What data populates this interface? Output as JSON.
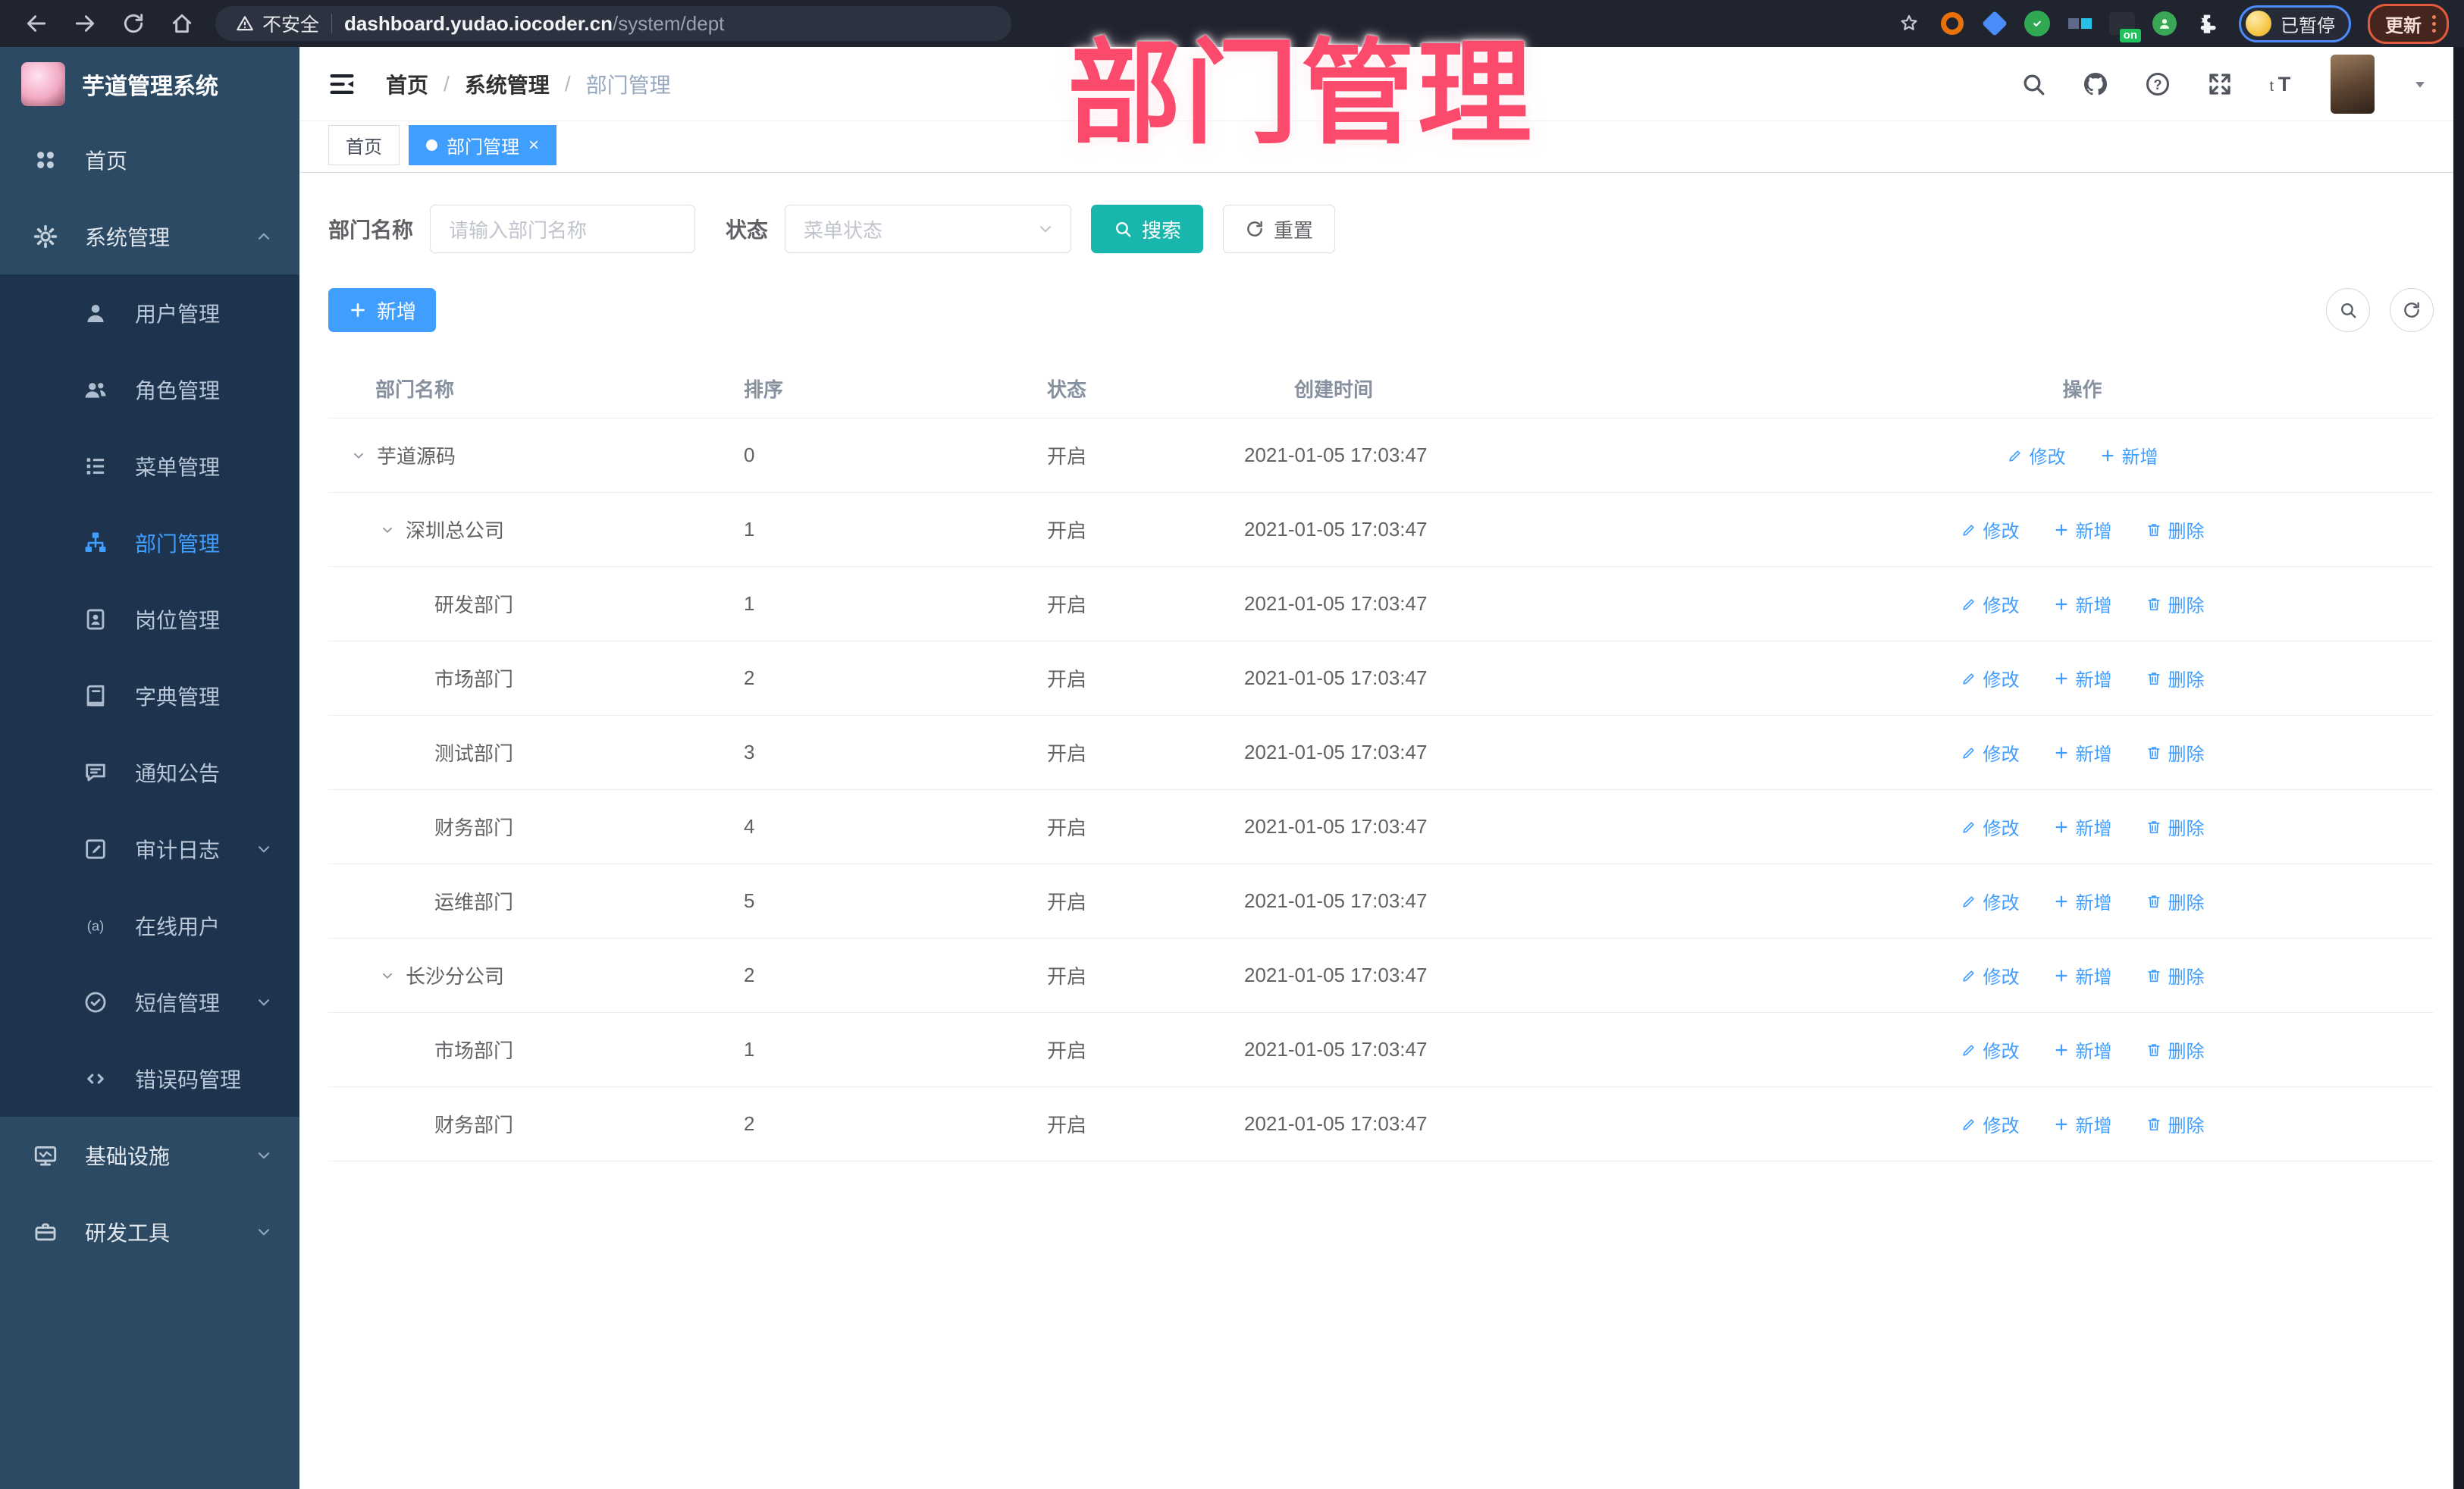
{
  "colors": {
    "accent": "#409eff",
    "search_button": "#18b6ad",
    "overlay_pink": "#fb4a6c",
    "sidebar_bg": "#2c4a64",
    "submenu_bg": "#1e344e"
  },
  "overlay_title": "部门管理",
  "browser": {
    "security_label": "不安全",
    "url_domain": "dashboard.yudao.iocoder.cn",
    "url_path": "/system/dept",
    "paused_label": "已暂停",
    "update_label": "更新",
    "extensions": [
      {
        "name": "gear-extension-icon",
        "kind": "ring",
        "color": "#e8710a"
      },
      {
        "name": "gem-extension-icon",
        "kind": "gem",
        "color": "#4a8df8"
      },
      {
        "name": "check-extension-icon",
        "kind": "check",
        "color": "#2faa53"
      },
      {
        "name": "cubes-extension-icon",
        "kind": "cubes",
        "color": "#5f6a8a"
      },
      {
        "name": "tampermonkey-extension-icon",
        "kind": "monkey",
        "color": "#2b2f3a",
        "badge": "on"
      },
      {
        "name": "person-extension-icon",
        "kind": "person",
        "color": "#3aa757"
      },
      {
        "name": "puzzle-extension-icon",
        "kind": "puzzle",
        "color": "#f1f3f4"
      }
    ]
  },
  "sidebar": {
    "title": "芋道管理系统",
    "items": [
      {
        "label": "首页",
        "icon": "dashboard-icon",
        "type": "top"
      },
      {
        "label": "系统管理",
        "icon": "gear-icon",
        "type": "top",
        "chevron": "up"
      },
      {
        "label": "用户管理",
        "icon": "user-icon",
        "type": "sub"
      },
      {
        "label": "角色管理",
        "icon": "users-icon",
        "type": "sub"
      },
      {
        "label": "菜单管理",
        "icon": "menu-list-icon",
        "type": "sub"
      },
      {
        "label": "部门管理",
        "icon": "org-tree-icon",
        "type": "sub",
        "active": true
      },
      {
        "label": "岗位管理",
        "icon": "badge-icon",
        "type": "sub"
      },
      {
        "label": "字典管理",
        "icon": "book-icon",
        "type": "sub"
      },
      {
        "label": "通知公告",
        "icon": "announcement-icon",
        "type": "sub"
      },
      {
        "label": "审计日志",
        "icon": "audit-log-icon",
        "type": "sub",
        "chevron": "down"
      },
      {
        "label": "在线用户",
        "icon": "online-user-icon",
        "type": "sub"
      },
      {
        "label": "短信管理",
        "icon": "sms-icon",
        "type": "sub",
        "chevron": "down"
      },
      {
        "label": "错误码管理",
        "icon": "code-icon",
        "type": "sub"
      },
      {
        "label": "基础设施",
        "icon": "monitor-icon",
        "type": "top",
        "chevron": "down"
      },
      {
        "label": "研发工具",
        "icon": "toolbox-icon",
        "type": "top",
        "chevron": "down"
      }
    ]
  },
  "header": {
    "breadcrumb": [
      "首页",
      "系统管理",
      "部门管理"
    ]
  },
  "tabs": [
    {
      "label": "首页",
      "active": false
    },
    {
      "label": "部门管理",
      "active": true,
      "closable": true
    }
  ],
  "filters": {
    "dept_label": "部门名称",
    "dept_placeholder": "请输入部门名称",
    "status_label": "状态",
    "status_placeholder": "菜单状态",
    "search_label": "搜索",
    "reset_label": "重置"
  },
  "toolbar": {
    "add_label": "新增"
  },
  "table": {
    "columns": [
      "部门名称",
      "排序",
      "状态",
      "创建时间",
      "操作"
    ],
    "action_labels": {
      "edit": "修改",
      "add": "新增",
      "delete": "删除"
    },
    "rows": [
      {
        "name": "芋道源码",
        "level": 0,
        "expandable": true,
        "sort": "0",
        "status": "开启",
        "created": "2021-01-05 17:03:47",
        "actions": [
          "edit",
          "add"
        ]
      },
      {
        "name": "深圳总公司",
        "level": 1,
        "expandable": true,
        "sort": "1",
        "status": "开启",
        "created": "2021-01-05 17:03:47",
        "actions": [
          "edit",
          "add",
          "delete"
        ]
      },
      {
        "name": "研发部门",
        "level": 2,
        "expandable": false,
        "sort": "1",
        "status": "开启",
        "created": "2021-01-05 17:03:47",
        "actions": [
          "edit",
          "add",
          "delete"
        ]
      },
      {
        "name": "市场部门",
        "level": 2,
        "expandable": false,
        "sort": "2",
        "status": "开启",
        "created": "2021-01-05 17:03:47",
        "actions": [
          "edit",
          "add",
          "delete"
        ]
      },
      {
        "name": "测试部门",
        "level": 2,
        "expandable": false,
        "sort": "3",
        "status": "开启",
        "created": "2021-01-05 17:03:47",
        "actions": [
          "edit",
          "add",
          "delete"
        ]
      },
      {
        "name": "财务部门",
        "level": 2,
        "expandable": false,
        "sort": "4",
        "status": "开启",
        "created": "2021-01-05 17:03:47",
        "actions": [
          "edit",
          "add",
          "delete"
        ]
      },
      {
        "name": "运维部门",
        "level": 2,
        "expandable": false,
        "sort": "5",
        "status": "开启",
        "created": "2021-01-05 17:03:47",
        "actions": [
          "edit",
          "add",
          "delete"
        ]
      },
      {
        "name": "长沙分公司",
        "level": 1,
        "expandable": true,
        "sort": "2",
        "status": "开启",
        "created": "2021-01-05 17:03:47",
        "actions": [
          "edit",
          "add",
          "delete"
        ]
      },
      {
        "name": "市场部门",
        "level": 2,
        "expandable": false,
        "sort": "1",
        "status": "开启",
        "created": "2021-01-05 17:03:47",
        "actions": [
          "edit",
          "add",
          "delete"
        ]
      },
      {
        "name": "财务部门",
        "level": 2,
        "expandable": false,
        "sort": "2",
        "status": "开启",
        "created": "2021-01-05 17:03:47",
        "actions": [
          "edit",
          "add",
          "delete"
        ]
      }
    ]
  }
}
